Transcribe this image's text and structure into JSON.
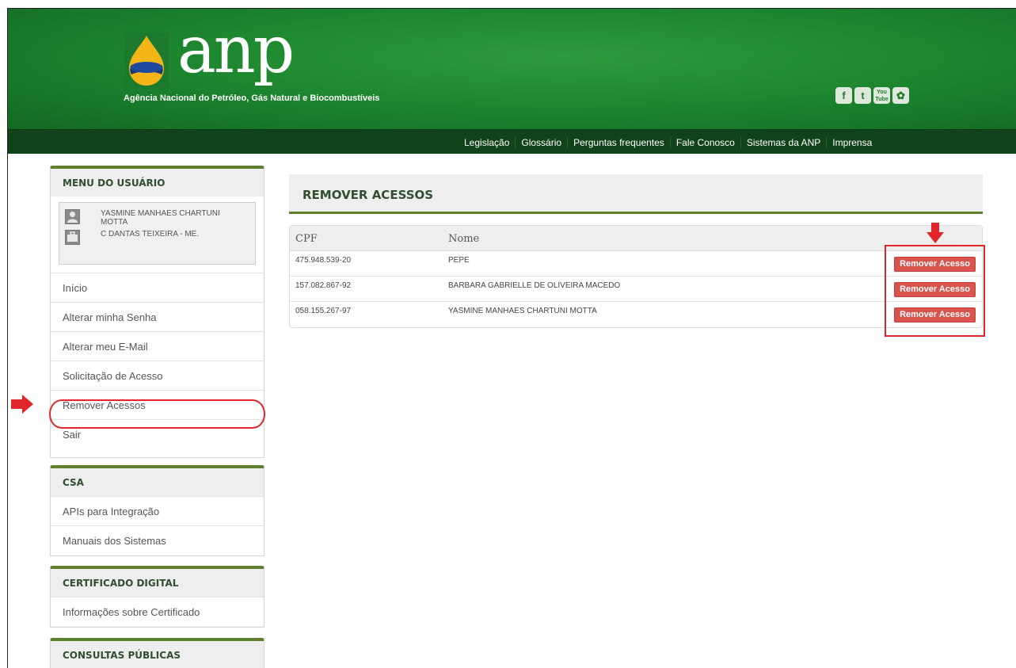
{
  "header": {
    "logo_text": "anp",
    "agency_name": "Agência Nacional do Petróleo, Gás Natural e Biocombustíveis",
    "social": [
      {
        "icon": "facebook-icon",
        "glyph": "f"
      },
      {
        "icon": "twitter-icon",
        "glyph": "t"
      },
      {
        "icon": "youtube-icon",
        "glyph": "You Tube"
      },
      {
        "icon": "flickr-icon",
        "glyph": "✿"
      }
    ]
  },
  "topnav": [
    "Legislação",
    "Glossário",
    "Perguntas frequentes",
    "Fale Conosco",
    "Sistemas da ANP",
    "Imprensa"
  ],
  "sidebar": {
    "user_menu": {
      "title": "MENU DO USUÁRIO",
      "user_name": "YASMINE MANHAES CHARTUNI MOTTA",
      "company": "C DANTAS TEIXEIRA - ME.",
      "items": [
        "Início",
        "Alterar minha Senha",
        "Alterar meu E-Mail",
        "Solicitação de Acesso",
        "Remover Acessos",
        "Sair"
      ]
    },
    "csa": {
      "title": "CSA",
      "items": [
        "APIs para Integração",
        "Manuais dos Sistemas"
      ]
    },
    "certificado": {
      "title": "CERTIFICADO DIGITAL",
      "items": [
        "Informações sobre Certificado"
      ]
    },
    "consultas": {
      "title": "CONSULTAS PÚBLICAS"
    }
  },
  "main": {
    "title": "REMOVER ACESSOS",
    "columns": {
      "cpf": "CPF",
      "nome": "Nome"
    },
    "rows": [
      {
        "cpf": "475.948.539-20",
        "nome": "PEPE",
        "action": "Remover Acesso"
      },
      {
        "cpf": "157.082.867-92",
        "nome": "BARBARA GABRIELLE DE OLIVEIRA MACEDO",
        "action": "Remover Acesso"
      },
      {
        "cpf": "058.155.267-97",
        "nome": "YASMINE MANHAES CHARTUNI MOTTA",
        "action": "Remover Acesso"
      }
    ]
  },
  "colors": {
    "header_green": "#1f8a30",
    "nav_dark_green": "#11431b",
    "accent_olive": "#5e7f2c",
    "button_red": "#d9534f",
    "annotation_red": "#e0262a"
  }
}
